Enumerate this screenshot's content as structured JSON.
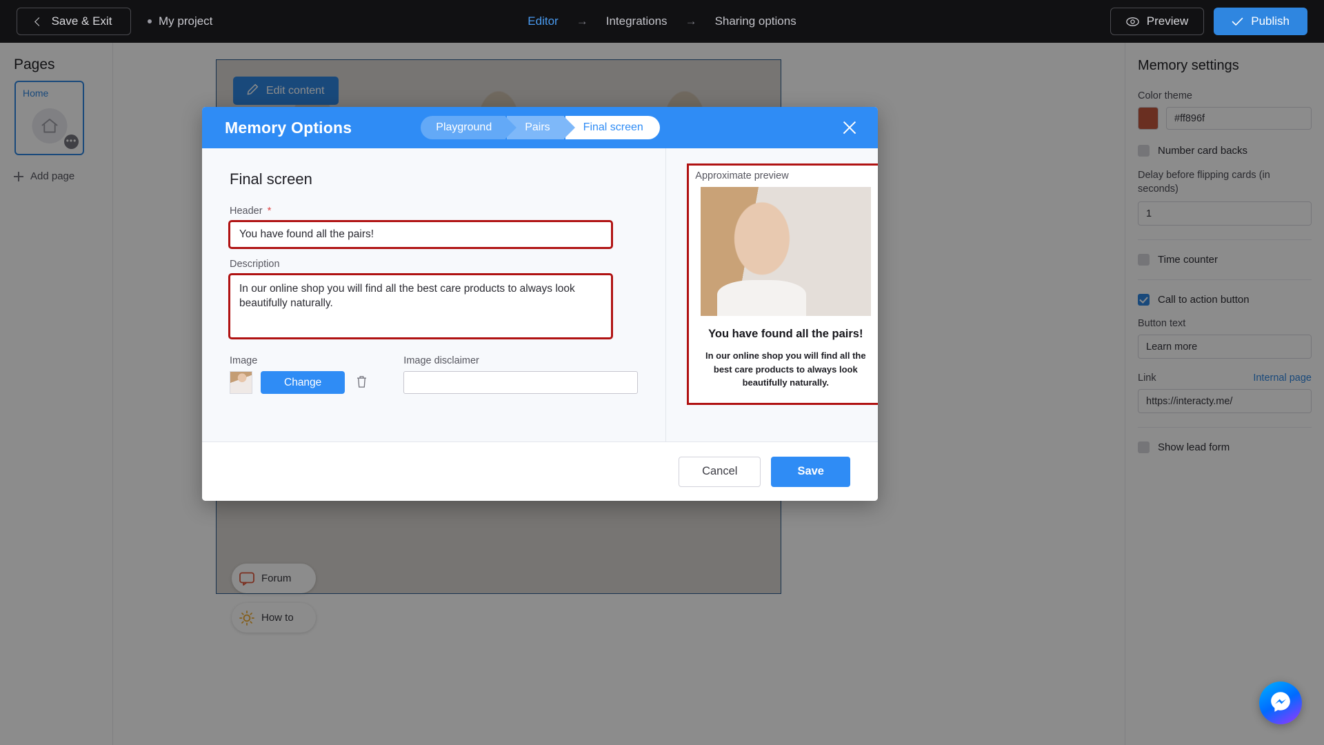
{
  "topbar": {
    "save_exit_label": "Save & Exit",
    "project_name": "My project",
    "crumbs": [
      {
        "label": "Editor",
        "active": true
      },
      {
        "label": "Integrations",
        "active": false
      },
      {
        "label": "Sharing options",
        "active": false
      }
    ],
    "arrow": "→",
    "preview_label": "Preview",
    "publish_label": "Publish"
  },
  "left_panel": {
    "title": "Pages",
    "page_card_label": "Home",
    "page_more_glyph": "•••",
    "add_page_label": "Add page",
    "helpers": [
      {
        "label": "Forum",
        "icon": "chat-icon"
      },
      {
        "label": "How to",
        "icon": "lightbulb-icon"
      }
    ]
  },
  "canvas": {
    "edit_content_label": "Edit content"
  },
  "modal": {
    "title": "Memory Options",
    "steps": [
      {
        "label": "Playground",
        "current": false
      },
      {
        "label": "Pairs",
        "current": false
      },
      {
        "label": "Final screen",
        "current": true
      }
    ],
    "section_title": "Final screen",
    "header_label": "Header",
    "header_required_mark": "*",
    "header_value": "You have found all the pairs!",
    "description_label": "Description",
    "description_value": "In our online shop you will find all the best care products to always look beautifully naturally.",
    "image_label": "Image",
    "change_button_label": "Change",
    "image_disclaimer_label": "Image disclaimer",
    "image_disclaimer_value": "",
    "preview_label": "Approximate preview",
    "preview_header": "You have found all the pairs!",
    "preview_description": "In our online shop you will find all the best care products to always look beautifully naturally.",
    "cancel_label": "Cancel",
    "save_label": "Save"
  },
  "right_panel": {
    "title": "Memory settings",
    "color_theme_label": "Color theme",
    "color_theme_value": "#ff896f",
    "color_swatch": "#c1563c",
    "number_card_backs_label": "Number card backs",
    "number_card_backs_checked": false,
    "delay_label": "Delay before flipping cards (in seconds)",
    "delay_value": "1",
    "time_counter_label": "Time counter",
    "time_counter_checked": false,
    "cta_label": "Call to action button",
    "cta_checked": true,
    "button_text_label": "Button text",
    "button_text_value": "Learn more",
    "link_label": "Link",
    "link_internal_label": "Internal page",
    "link_value": "https://interacty.me/",
    "show_lead_form_label": "Show lead form",
    "show_lead_form_checked": false
  }
}
